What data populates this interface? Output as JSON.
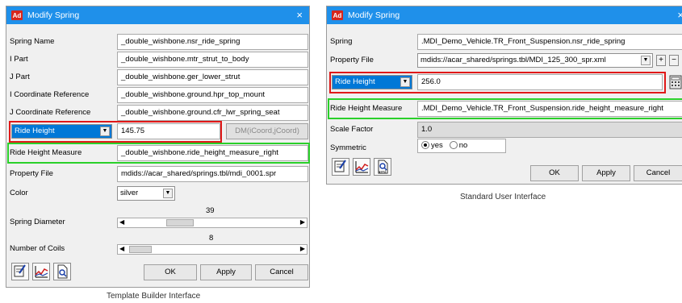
{
  "left": {
    "title": "Modify Spring",
    "app_icon": "Ad",
    "close": "×",
    "rows": [
      {
        "label": "Spring Name",
        "value": "_double_wishbone.nsr_ride_spring"
      },
      {
        "label": "I Part",
        "value": "_double_wishbone.mtr_strut_to_body"
      },
      {
        "label": "J Part",
        "value": "_double_wishbone.ger_lower_strut"
      },
      {
        "label": "I Coordinate Reference",
        "value": "_double_wishbone.ground.hpr_top_mount"
      },
      {
        "label": "J Coordinate Reference",
        "value": "_double_wishbone.ground.cfr_lwr_spring_seat"
      }
    ],
    "ride_height_option": "Ride Height",
    "ride_height_value": "145.75",
    "dm_button": "DM(iCoord,jCoord)",
    "measure_label": "Ride Height Measure",
    "measure_value": "_double_wishbone.ride_height_measure_right",
    "property_file_label": "Property File",
    "property_file_value": "mdids://acar_shared/springs.tbl/mdi_0001.spr",
    "color_label": "Color",
    "color_value": "silver",
    "diameter_label": "Spring Diameter",
    "diameter_value": "39",
    "coils_label": "Number of Coils",
    "coils_value": "8",
    "ok": "OK",
    "apply": "Apply",
    "cancel": "Cancel",
    "caption": "Template Builder Interface"
  },
  "right": {
    "title": "Modify Spring",
    "app_icon": "Ad",
    "close": "×",
    "spring_label": "Spring",
    "spring_value": ".MDI_Demo_Vehicle.TR_Front_Suspension.nsr_ride_spring",
    "property_file_label": "Property File",
    "property_file_value": "mdids://acar_shared/springs.tbl/MDI_125_300_spr.xml",
    "plus": "+",
    "minus": "−",
    "ride_height_option": "Ride Height",
    "ride_height_value": "256.0",
    "measure_label": "Ride Height Measure",
    "measure_value": ".MDI_Demo_Vehicle.TR_Front_Suspension.ride_height_measure_right",
    "scale_label": "Scale Factor",
    "scale_value": "1.0",
    "symmetric_label": "Symmetric",
    "yes": "yes",
    "no": "no",
    "ok": "OK",
    "apply": "Apply",
    "cancel": "Cancel",
    "caption": "Standard User Interface"
  }
}
